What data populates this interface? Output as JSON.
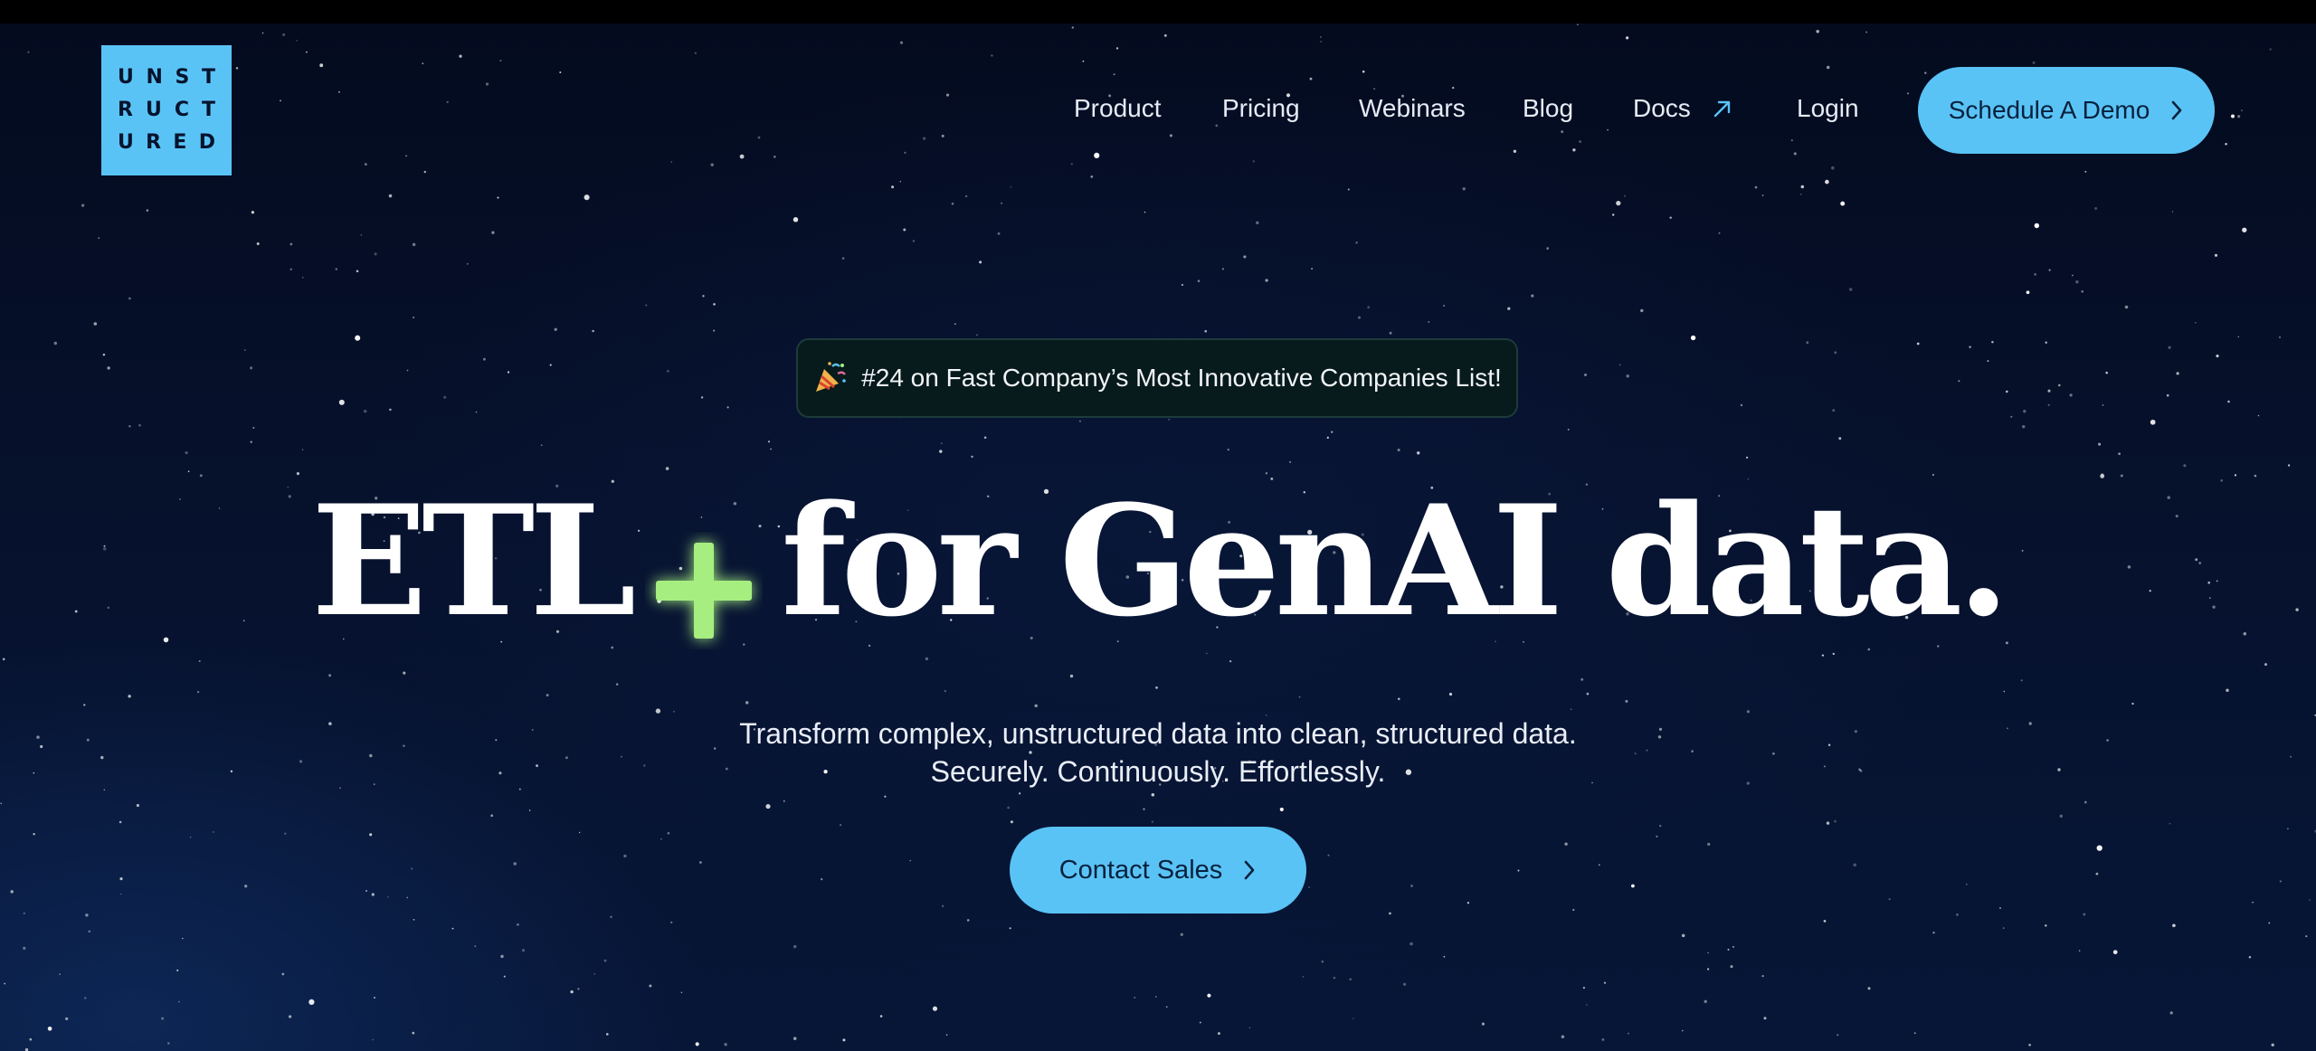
{
  "logo": {
    "rows": [
      "UNST",
      "RUCT",
      "URED"
    ],
    "background": "#5ac3f6"
  },
  "nav": {
    "items": [
      "Product",
      "Pricing",
      "Webinars",
      "Blog",
      "Docs",
      "Login"
    ],
    "docs_icon": "external-arrow-icon",
    "demo_button": "Schedule A Demo",
    "demo_icon": "chevron-right-icon"
  },
  "badge": {
    "icon": "party-popper-icon",
    "text": "#24 on Fast Company’s Most Innovative Companies List!"
  },
  "hero": {
    "headline_left": "ETL",
    "headline_icon": "plus-icon",
    "headline_right": "for GenAI data.",
    "subtitle_line1": "Transform complex, unstructured data into clean, structured data.",
    "subtitle_line2": "Securely. Continuously. Effortlessly.",
    "cta": "Contact Sales",
    "cta_icon": "chevron-right-icon"
  },
  "colors": {
    "accent": "#5ac3f6",
    "plus": "#a6ee80",
    "background": "#06112c"
  }
}
